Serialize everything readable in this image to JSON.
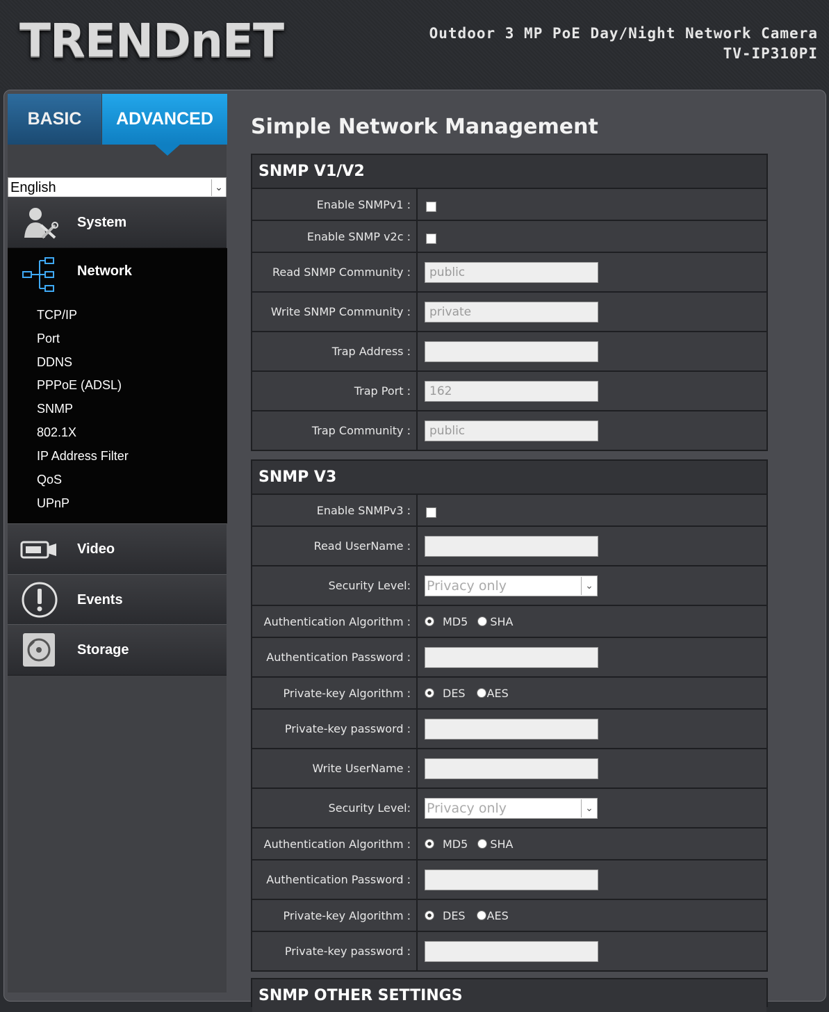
{
  "header": {
    "logo": "TRENDnET",
    "model_line1": "Outdoor 3 MP PoE Day/Night Network Camera",
    "model_line2": "TV-IP310PI"
  },
  "tabs": {
    "basic": "BASIC",
    "advanced": "ADVANCED"
  },
  "language": {
    "selected": "English"
  },
  "nav": {
    "system": "System",
    "network": "Network",
    "network_sub": [
      "TCP/IP",
      "Port",
      "DDNS",
      "PPPoE (ADSL)",
      "SNMP",
      "802.1X",
      "IP Address Filter",
      "QoS",
      "UPnP"
    ],
    "video": "Video",
    "events": "Events",
    "storage": "Storage"
  },
  "page": {
    "title": "Simple Network Management"
  },
  "snmp_v1v2": {
    "title": "SNMP V1/V2",
    "enable_v1_label": "Enable SNMPv1 :",
    "enable_v2c_label": "Enable SNMP v2c :",
    "read_community_label": "Read SNMP Community :",
    "read_community_value": "public",
    "write_community_label": "Write SNMP Community :",
    "write_community_value": "private",
    "trap_address_label": "Trap Address :",
    "trap_address_value": "",
    "trap_port_label": "Trap Port :",
    "trap_port_value": "162",
    "trap_community_label": "Trap Community :",
    "trap_community_value": "public"
  },
  "snmp_v3": {
    "title": "SNMP V3",
    "enable_v3_label": "Enable SNMPv3 :",
    "read_username_label": "Read UserName :",
    "security_level_label": "Security Level:",
    "security_level_value": "Privacy only",
    "auth_algo_label": "Authentication Algorithm :",
    "auth_md5": "MD5",
    "auth_sha": "SHA",
    "auth_password_label": "Authentication Password :",
    "priv_algo_label": "Private-key Algorithm :",
    "priv_des": "DES",
    "priv_aes": "AES",
    "priv_password_label": "Private-key password :",
    "write_username_label": "Write UserName :"
  },
  "snmp_other": {
    "title": "SNMP OTHER SETTINGS"
  }
}
